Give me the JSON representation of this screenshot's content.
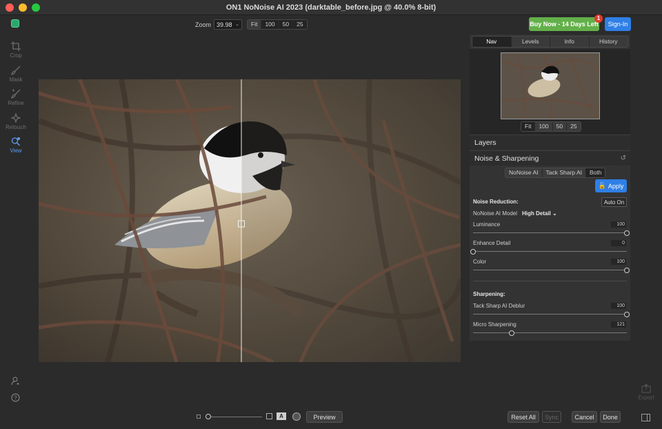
{
  "window": {
    "title": "ON1 NoNoise AI 2023 (darktable_before.jpg @ 40.0% 8-bit)"
  },
  "tools": [
    {
      "label": "Crop",
      "icon": "crop-icon"
    },
    {
      "label": "Mask",
      "icon": "brush-icon"
    },
    {
      "label": "Refine",
      "icon": "refine-brush-icon"
    },
    {
      "label": "Retouch",
      "icon": "retouch-icon"
    },
    {
      "label": "View",
      "icon": "zoom-view-icon",
      "active": true
    }
  ],
  "zoom": {
    "label": "Zoom",
    "value": "39.98",
    "presets": [
      "Fit",
      "100",
      "50",
      "25"
    ]
  },
  "header": {
    "buy_label": "Buy Now - 14 Days Left",
    "badge_count": "1",
    "signin_label": "Sign-In"
  },
  "nav": {
    "tabs": [
      "Nav",
      "Levels",
      "Info",
      "History"
    ],
    "presets": [
      "Fit",
      "100",
      "50",
      "25"
    ]
  },
  "layers": {
    "title": "Layers"
  },
  "noise": {
    "title": "Noise & Sharpening",
    "modes": [
      "NoNoise AI",
      "Tack Sharp AI",
      "Both"
    ],
    "apply_label": "Apply",
    "reduction_label": "Noise Reduction:",
    "auto_label": "Auto On",
    "model_label": "NoNoise AI Model",
    "model_value": "High Detail",
    "sliders": [
      {
        "label": "Luminance",
        "value": "100",
        "level": 1.0
      },
      {
        "label": "Enhance Detail",
        "value": "0",
        "level": 0.0
      },
      {
        "label": "Color",
        "value": "100",
        "level": 1.0
      }
    ],
    "sharpening_label": "Sharpening:",
    "sharp_sliders": [
      {
        "label": "Tack Sharp AI Deblur",
        "value": "100",
        "level": 1.0
      },
      {
        "label": "Micro Sharpening",
        "value": "121",
        "level": 0.25
      }
    ]
  },
  "bottom": {
    "preview_label": "Preview",
    "reset_label": "Reset All",
    "sync_label": "Sync",
    "cancel_label": "Cancel",
    "done_label": "Done",
    "export_label": "Export",
    "view_mode_letter": "A"
  },
  "colors": {
    "accent": "#2f7fe6",
    "buy": "#63b04a",
    "badge": "#e23b2e"
  }
}
